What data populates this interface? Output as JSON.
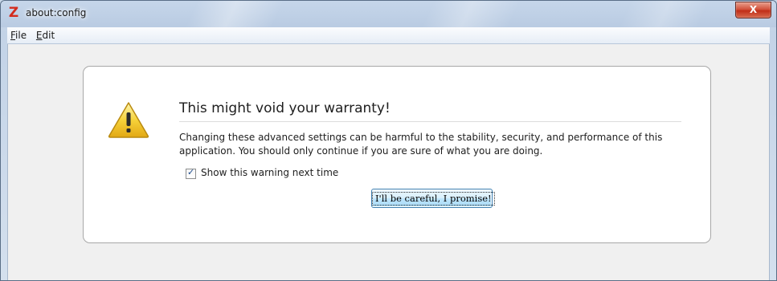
{
  "window": {
    "title": "about:config",
    "close_glyph": "X",
    "app_icon_glyph": "Z",
    "app_icon_color": "#d32b1d"
  },
  "menubar": {
    "items": [
      {
        "accel": "F",
        "rest": "ile"
      },
      {
        "accel": "E",
        "rest": "dit"
      }
    ]
  },
  "warning": {
    "icon": "warning-triangle-icon",
    "heading": "This might void your warranty!",
    "description": "Changing these advanced settings can be harmful to the stability, security, and performance of this application. You should only continue if you are sure of what you are doing.",
    "checkbox_label": "Show this warning next time",
    "checkbox_checked": true,
    "checkbox_mark": "✓",
    "button_label": "I'll be careful, I promise!"
  },
  "colors": {
    "accent": "#3c7fb1",
    "warning_yellow": "#f6d23a"
  }
}
